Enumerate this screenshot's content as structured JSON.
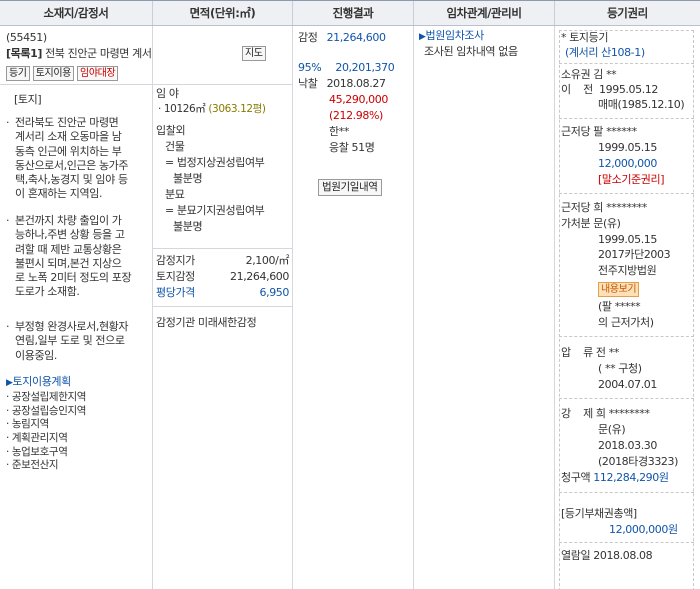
{
  "headers": [
    "소재지/감정서",
    "면적(단위:㎡)",
    "진행결과",
    "임차관계/관리비",
    "등기권리"
  ],
  "location": {
    "case_no": "(55451)",
    "item": "[목록1]",
    "address": "전북 진안군 마령면 계서리 산 ***",
    "map_btn": "지도",
    "btn_registry": "등기",
    "btn_land_use": "토지이용",
    "btn_lease": "임야대장",
    "section_title": "[토지]",
    "bullets": [
      [
        "전라북도 진안군 마령면",
        "계서리 소재 오동마을 남",
        "동측 인근에 위치하는 부",
        "동산으로서,인근은 농가주",
        "택,축사,농경지 및 임야 등",
        "이 혼재하는 지역임."
      ],
      [
        "본건까지 차량 출입이 가",
        "능하나,주변 상황 등을 고",
        "려할 때 제반 교통상황은",
        "불편시 되며,본건 지상으",
        "로 노폭 2미터 정도의 포장",
        "도로가 소재함."
      ],
      [
        "부정형 완경사로서,현황자",
        "연림,일부 도로 및 전으로",
        "이용중임."
      ]
    ],
    "land_plan_title": "토지이용계획",
    "land_plan_items": [
      "공장설립제한지역",
      "공장설립승인지역",
      "농림지역",
      "계획관리지역",
      "농업보호구역",
      "준보전산지"
    ]
  },
  "area": {
    "category": "임 야",
    "area_value": "10126㎡",
    "area_pyeong": "(3063.12평)",
    "excluded_title": "입찰외",
    "building": "건물",
    "building_note1": "= 법정지상권성립여부",
    "building_note2": "불분명",
    "grave": "분묘",
    "grave_note1": "= 분묘기지권성립여부",
    "grave_note2": "불분명",
    "land_price_label": "감정지가",
    "land_price_value": "2,100/㎡",
    "land_appraisal_label": "토지감정",
    "land_appraisal_value": "21,264,600",
    "avg_price_label": "평당가격",
    "avg_price_value": "6,950",
    "appraiser": "감정기관  미래새한감정"
  },
  "progress": {
    "appraisal_label": "감정",
    "appraisal_value": "21,264,600",
    "rate": "95%",
    "min_bid": "20,201,370",
    "sold_label": "낙찰",
    "sold_date": "2018.08.27",
    "sold_price": "45,290,000",
    "sold_ratio": "(212.98%)",
    "bidder": "한**",
    "bidders_count": "응찰 51명",
    "court_date_btn": "법원기일내역"
  },
  "lease": {
    "title": "법원임차조사",
    "text": "조사된 임차내역 없음"
  },
  "registry": {
    "land_title": "* 토지등기",
    "land_addr": "(계서리 산108-1)",
    "owner_label": "소유권 김 **",
    "owner_l2": "이    전  1995.05.12",
    "owner_l3": "매매(1985.12.10)",
    "mortgage1_l1": "근저당 팔 ******",
    "mortgage1_l2": "1999.05.15",
    "mortgage1_l3": "12,000,000",
    "mortgage1_l4": "[말소기준권리]",
    "mortgage2_l1": "근저당 희 ********",
    "mortgage2_l2": "가처분 문(유)",
    "mortgage2_l3": "1999.05.15",
    "mortgage2_l4": "2017카단2003",
    "mortgage2_l5": "전주지방법원",
    "content_btn": "내용보기",
    "mortgage2_l6": "(팔 *****",
    "mortgage2_l7": "의 근저가처)",
    "seizure_l1": "압    류 전 **",
    "seizure_l2": "( ** 구청)",
    "seizure_l3": "2004.07.01",
    "forced_l1": "강    제 희 ********",
    "forced_l2": "문(유)",
    "forced_l3": "2018.03.30",
    "forced_l4": "(2018타경3323)",
    "claim_label": "청구액",
    "claim_value": "112,284,290원",
    "total_title": "[등기부채권총액]",
    "total_value": "12,000,000원",
    "view_date": "열람일 2018.08.08"
  }
}
